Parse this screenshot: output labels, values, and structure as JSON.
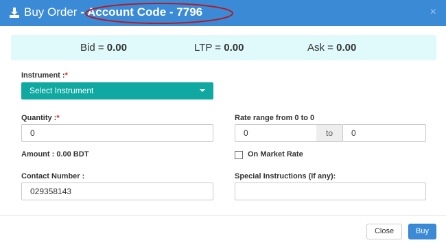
{
  "header": {
    "title_prefix": "Buy Order",
    "title_suffix": "- Account Code - 7796",
    "close_glyph": "×",
    "icons": {
      "download": "download-icon",
      "close": "close-icon"
    },
    "accent_color": "#3b8ad6"
  },
  "prices": {
    "bid_label": "Bid = ",
    "bid_value": "0.00",
    "ltp_label": "LTP = ",
    "ltp_value": "0.00",
    "ask_label": "Ask = ",
    "ask_value": "0.00"
  },
  "form": {
    "instrument_label": "Instrument :",
    "required_mark": "*",
    "instrument_selected": "Select Instrument",
    "quantity_label": "Quantity :",
    "quantity_value": "0",
    "rate_range_prefix": "Rate range from ",
    "rate_from_bold": "0",
    "rate_to_text": " to ",
    "rate_to_bold": "0",
    "rate_from_value": "0",
    "rate_to_addon": "to",
    "rate_to_value": "0",
    "amount_label": "Amount : ",
    "amount_value": "0.00",
    "amount_currency": " BDT",
    "market_rate_label": "On Market Rate",
    "contact_label": "Contact Number :",
    "contact_value": "029358143",
    "special_label": "Special Instructions (If any):",
    "special_value": ""
  },
  "footer": {
    "close_label": "Close",
    "buy_label": "Buy"
  },
  "colors": {
    "select_bg": "#0fa9a1",
    "price_panel_bg": "#e0f9fb",
    "highlight_ellipse": "#b01e2a"
  }
}
